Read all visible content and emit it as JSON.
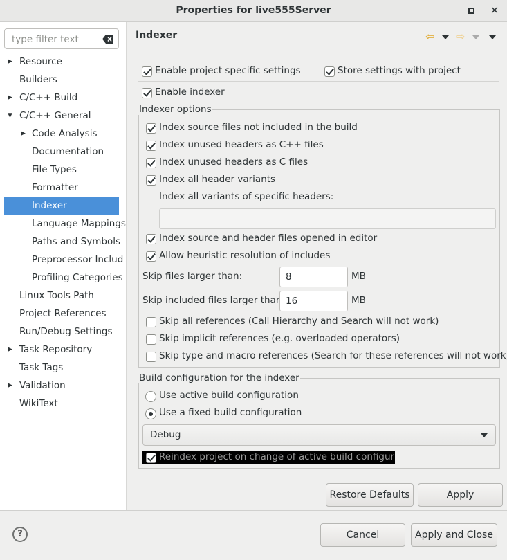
{
  "window": {
    "title": "Properties for live555Server"
  },
  "filter": {
    "placeholder": "type filter text"
  },
  "tree": [
    {
      "label": "Resource",
      "expander": "collapsed"
    },
    {
      "label": "Builders",
      "expander": "none"
    },
    {
      "label": "C/C++ Build",
      "expander": "collapsed"
    },
    {
      "label": "C/C++ General",
      "expander": "expanded"
    },
    {
      "label": "Code Analysis",
      "expander": "collapsed"
    },
    {
      "label": "Documentation",
      "expander": "none"
    },
    {
      "label": "File Types",
      "expander": "none"
    },
    {
      "label": "Formatter",
      "expander": "none"
    },
    {
      "label": "Indexer",
      "expander": "none",
      "selected": true
    },
    {
      "label": "Language Mappings",
      "expander": "none"
    },
    {
      "label": "Paths and Symbols",
      "expander": "none"
    },
    {
      "label": "Preprocessor Includ",
      "expander": "none"
    },
    {
      "label": "Profiling Categories",
      "expander": "none"
    },
    {
      "label": "Linux Tools Path",
      "expander": "none"
    },
    {
      "label": "Project References",
      "expander": "none"
    },
    {
      "label": "Run/Debug Settings",
      "expander": "none"
    },
    {
      "label": "Task Repository",
      "expander": "collapsed"
    },
    {
      "label": "Task Tags",
      "expander": "none"
    },
    {
      "label": "Validation",
      "expander": "collapsed"
    },
    {
      "label": "WikiText",
      "expander": "none"
    }
  ],
  "page": {
    "title": "Indexer"
  },
  "top_options": {
    "enable_project_specific": {
      "label": "Enable project specific settings",
      "checked": true
    },
    "store_with_project": {
      "label": "Store settings with project",
      "checked": true
    },
    "enable_indexer": {
      "label": "Enable indexer",
      "checked": true
    }
  },
  "indexer_options": {
    "title": "Indexer options",
    "index_source_not_in_build": {
      "label": "Index source files not included in the build",
      "checked": true
    },
    "index_unused_cpp": {
      "label": "Index unused headers as C++ files",
      "checked": true
    },
    "index_unused_c": {
      "label": "Index unused headers as C files",
      "checked": true
    },
    "index_all_variants": {
      "label": "Index all header variants",
      "checked": true
    },
    "variants_specific_label": "Index all variants of specific headers:",
    "variants_specific_value": "",
    "index_opened_in_editor": {
      "label": "Index source and header files opened in editor",
      "checked": true
    },
    "heuristic_resolution": {
      "label": "Allow heuristic resolution of includes",
      "checked": true
    },
    "skip_files_label": "Skip files larger than:",
    "skip_files_value": "8",
    "skip_included_label": "Skip included files larger than:",
    "skip_included_value": "16",
    "unit": "MB",
    "skip_all_refs": {
      "label": "Skip all references (Call Hierarchy and Search will not work)",
      "checked": false
    },
    "skip_implicit_refs": {
      "label": "Skip implicit references (e.g. overloaded operators)",
      "checked": false
    },
    "skip_type_macro_refs": {
      "label": "Skip type and macro references (Search for these references will not work)",
      "checked": false
    }
  },
  "build_config": {
    "title": "Build configuration for the indexer",
    "use_active": {
      "label": "Use active build configuration",
      "selected": false
    },
    "use_fixed": {
      "label": "Use a fixed build configuration",
      "selected": true
    },
    "selected_config": "Debug",
    "reindex": {
      "label": "Reindex project on change of active build configuratio",
      "checked": true
    }
  },
  "buttons": {
    "restore_defaults": "Restore Defaults",
    "apply": "Apply",
    "cancel": "Cancel",
    "apply_and_close": "Apply and Close"
  },
  "colors": {
    "selection": "#4a90d9",
    "panel_bg": "#efefee",
    "nav_arrow": "#e0a829"
  }
}
